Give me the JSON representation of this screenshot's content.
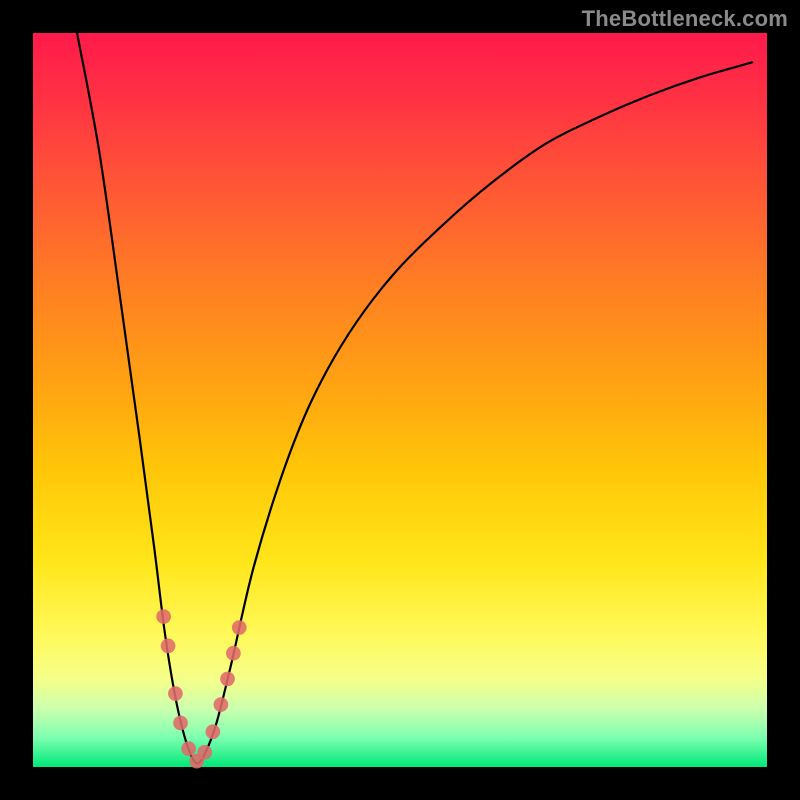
{
  "watermark": "TheBottleneck.com",
  "chart_data": {
    "type": "line",
    "title": "",
    "xlabel": "",
    "ylabel": "",
    "xlim": [
      0,
      100
    ],
    "ylim": [
      0,
      100
    ],
    "grid": false,
    "legend": false,
    "series": [
      {
        "name": "bottleneck-curve",
        "color": "#000000",
        "x": [
          6,
          9,
          12,
          14.5,
          16.5,
          18,
          19.5,
          21,
          22.3,
          23.5,
          25,
          27,
          30,
          34,
          38,
          43,
          49,
          56,
          63,
          70,
          77,
          84,
          91,
          98
        ],
        "y": [
          100,
          84,
          63,
          45,
          30,
          18,
          9,
          3,
          0.5,
          2,
          6,
          14,
          27,
          40,
          50,
          59,
          67,
          74,
          80,
          85,
          88.5,
          91.5,
          94,
          96
        ]
      }
    ],
    "markers": {
      "name": "highlight-dots",
      "color": "#e06a6a",
      "radius_pct": 1.0,
      "points": [
        {
          "x": 17.8,
          "y": 20.5
        },
        {
          "x": 18.4,
          "y": 16.5
        },
        {
          "x": 19.4,
          "y": 10.0
        },
        {
          "x": 20.1,
          "y": 6.0
        },
        {
          "x": 21.2,
          "y": 2.5
        },
        {
          "x": 22.3,
          "y": 0.8
        },
        {
          "x": 23.4,
          "y": 2.0
        },
        {
          "x": 24.5,
          "y": 4.8
        },
        {
          "x": 25.6,
          "y": 8.5
        },
        {
          "x": 26.5,
          "y": 12.0
        },
        {
          "x": 27.3,
          "y": 15.5
        },
        {
          "x": 28.1,
          "y": 19.0
        }
      ]
    }
  }
}
